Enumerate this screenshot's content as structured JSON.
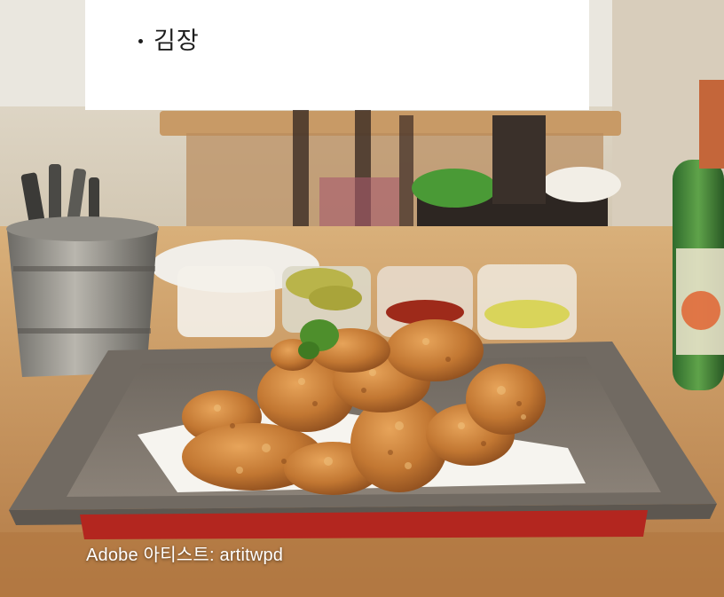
{
  "card": {
    "items": [
      "김장"
    ]
  },
  "credit": {
    "text": "Adobe 아티스트: artitwpd"
  }
}
